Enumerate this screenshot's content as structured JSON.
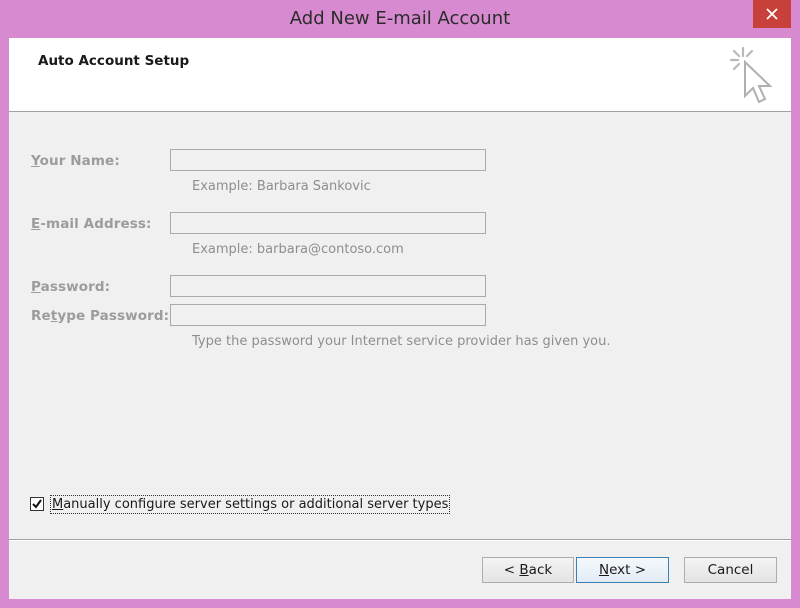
{
  "window": {
    "title": "Add New E-mail Account",
    "close_glyph": "×"
  },
  "header": {
    "title": "Auto Account Setup",
    "icon": "wizard-cursor-icon"
  },
  "form": {
    "name": {
      "label_access": "Y",
      "label_rest": "our Name:",
      "value": "",
      "hint": "Example: Barbara Sankovic"
    },
    "email": {
      "label_access": "E",
      "label_rest": "-mail Address:",
      "value": "",
      "hint": "Example: barbara@contoso.com"
    },
    "password": {
      "label_access": "P",
      "label_rest": "assword:",
      "value": ""
    },
    "retype": {
      "label_pre": "Re",
      "label_access": "t",
      "label_rest": "ype Password:",
      "value": ""
    },
    "password_hint": "Type the password your Internet service provider has given you."
  },
  "manual_config": {
    "checked": true,
    "label_access": "M",
    "label_rest": "anually configure server settings or additional server types"
  },
  "buttons": {
    "back_pre": "< ",
    "back_access": "B",
    "back_rest": "ack",
    "next_access": "N",
    "next_rest": "ext >",
    "cancel": "Cancel"
  },
  "colors": {
    "frame": "#d88ad0",
    "close": "#c7413a",
    "disabled_text": "#9c9c9c"
  }
}
